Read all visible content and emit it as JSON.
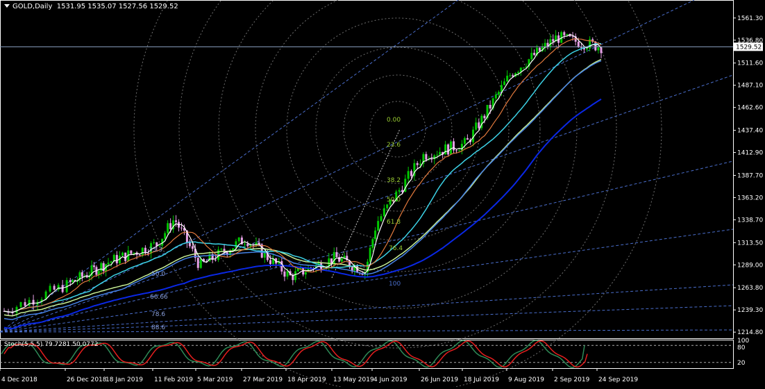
{
  "header": {
    "symbol": "GOLD,Daily",
    "ohlc": "1531.95 1535.07 1527.56 1529.52"
  },
  "current_price_label": "1529.52",
  "stochastic": {
    "label": "Stoch(5,5,5) 79.7281 50.0772",
    "levels_printed": [
      "80",
      "100",
      "20"
    ]
  },
  "colors": {
    "background": "#000000",
    "bull_candle": "#00c800",
    "bear_candle": "#e6a0e6",
    "ma_fast": "#ffffff",
    "ma_orange": "#e0783c",
    "ma_cyan": "#3cd2e6",
    "ma_blue": "#4682e6",
    "ma_lightgreen": "#c8f096",
    "ma_dark_blue": "#0a28e6",
    "fib_lines": "#4a6ecc",
    "fib_circles": "#6e6e6e",
    "stoch_main": "#2e8b57",
    "stoch_signal": "#e61e1e"
  },
  "fib_fan_labels": [
    {
      "text": "0.00",
      "color": "#9acd32"
    },
    {
      "text": "23.6",
      "color": "#9acd32"
    },
    {
      "text": "38.2",
      "color": "#9acd32"
    },
    {
      "text": "50.0",
      "color": "#9acd32"
    },
    {
      "text": "61.8",
      "color": "#9acd32"
    },
    {
      "text": "76.4",
      "color": "#9acd32"
    },
    {
      "text": "100",
      "color": "#4a6ecc"
    },
    {
      "text": "33.3",
      "color": "#8aa0dc"
    },
    {
      "text": "50.0",
      "color": "#8aa0dc"
    },
    {
      "text": "66.66",
      "color": "#8aa0dc"
    },
    {
      "text": "78.6",
      "color": "#8aa0dc"
    },
    {
      "text": "88.6",
      "color": "#8aa0dc"
    }
  ],
  "chart_data": {
    "type": "candlestick",
    "title": "GOLD,Daily",
    "xlabel": "",
    "ylabel": "",
    "ylim": [
      1208,
      1575
    ],
    "y_ticks": [
      "1561.30",
      "1536.80",
      "1511.60",
      "1487.10",
      "1462.60",
      "1437.40",
      "1412.90",
      "1387.70",
      "1363.20",
      "1338.70",
      "1313.50",
      "1289.00",
      "1263.80",
      "1239.30",
      "1214.80"
    ],
    "x_ticks": [
      "4 Dec 2018",
      "26 Dec 2018",
      "18 Jan 2019",
      "11 Feb 2019",
      "5 Mar 2019",
      "27 Mar 2019",
      "18 Apr 2019",
      "13 May 2019",
      "4 Jun 2019",
      "26 Jun 2019",
      "18 Jul 2019",
      "9 Aug 2019",
      "2 Sep 2019",
      "24 Sep 2019"
    ],
    "grid": false,
    "approx_close_path": [
      [
        "4 Dec 2018",
        1238
      ],
      [
        "26 Dec 2018",
        1268
      ],
      [
        "18 Jan 2019",
        1292
      ],
      [
        "11 Feb 2019",
        1312
      ],
      [
        "20 Feb 2019",
        1340
      ],
      [
        "5 Mar 2019",
        1288
      ],
      [
        "27 Mar 2019",
        1318
      ],
      [
        "18 Apr 2019",
        1276
      ],
      [
        "13 May 2019",
        1297
      ],
      [
        "29 May 2019",
        1282
      ],
      [
        "4 Jun 2019",
        1335
      ],
      [
        "26 Jun 2019",
        1410
      ],
      [
        "18 Jul 2019",
        1423
      ],
      [
        "9 Aug 2019",
        1500
      ],
      [
        "2 Sep 2019",
        1540
      ],
      [
        "24 Sep 2019",
        1529.52
      ]
    ],
    "current_price": 1529.52,
    "subchart": {
      "type": "line",
      "name": "Stoch(5,5,5)",
      "main_value": 79.7281,
      "signal_value": 50.0772,
      "ylim": [
        0,
        100
      ],
      "levels": [
        80,
        20
      ]
    }
  }
}
